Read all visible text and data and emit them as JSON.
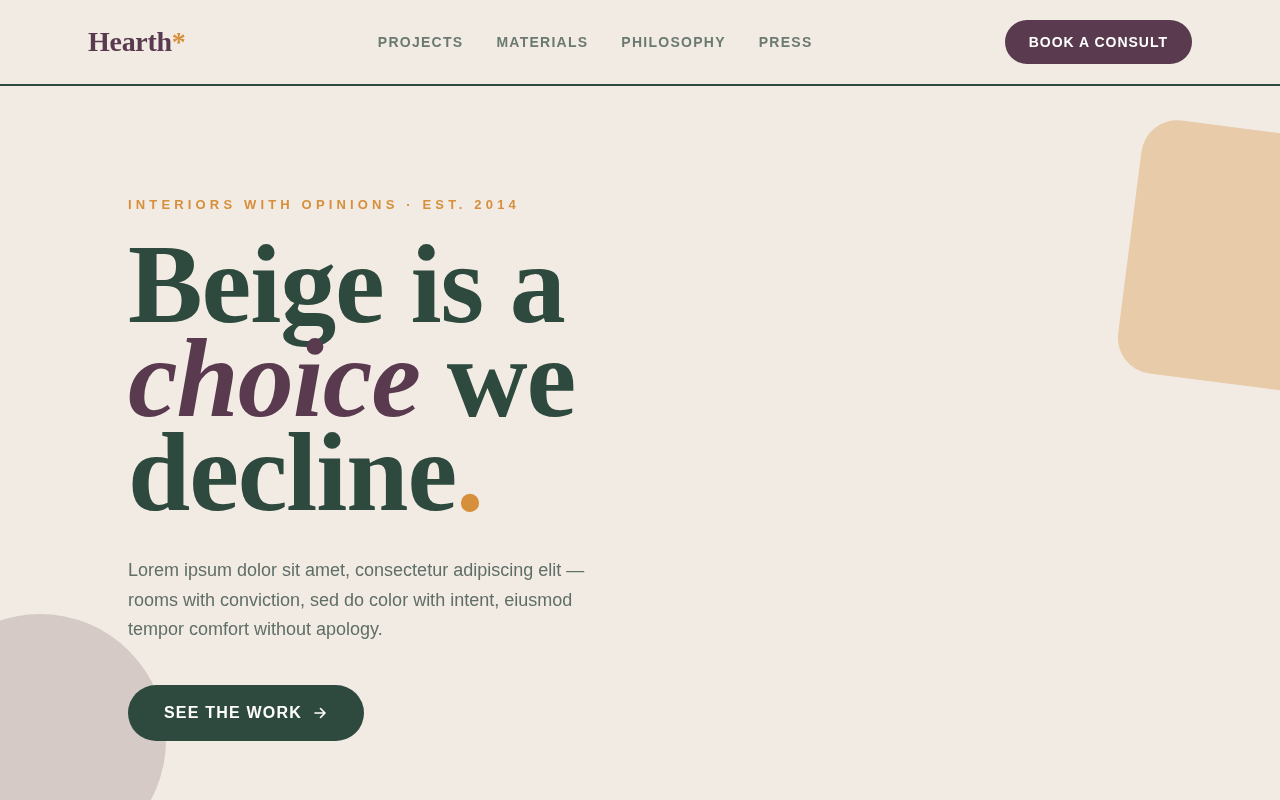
{
  "header": {
    "logo": {
      "text": "Hearth",
      "mark": "*"
    },
    "nav": [
      {
        "label": "PROJECTS"
      },
      {
        "label": "MATERIALS"
      },
      {
        "label": "PHILOSOPHY"
      },
      {
        "label": "PRESS"
      }
    ],
    "cta": {
      "label": "BOOK A CONSULT"
    }
  },
  "hero": {
    "eyebrow": "INTERIORS WITH OPINIONS · EST. 2014",
    "headline": {
      "text": "Beige is a *choice* we decline",
      "end_mark": "."
    },
    "body": "Lorem ipsum dolor sit amet, consectetur adipiscing elit — rooms with conviction, sed do color with intent, eiusmod tempor comfort without apology.",
    "button": {
      "label": "SEE THE WORK"
    }
  }
}
